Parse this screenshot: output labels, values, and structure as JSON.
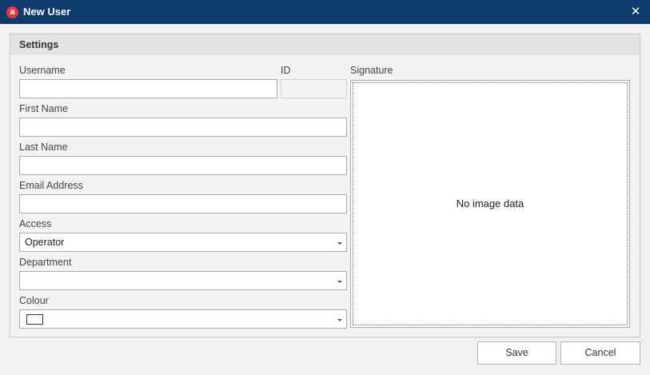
{
  "window": {
    "title": "New User",
    "app_icon_letter": "a"
  },
  "group": {
    "title": "Settings"
  },
  "fields": {
    "username": {
      "label": "Username",
      "value": ""
    },
    "id": {
      "label": "ID",
      "value": ""
    },
    "first_name": {
      "label": "First Name",
      "value": ""
    },
    "last_name": {
      "label": "Last Name",
      "value": ""
    },
    "email": {
      "label": "Email Address",
      "value": ""
    },
    "access": {
      "label": "Access",
      "value": "Operator"
    },
    "department": {
      "label": "Department",
      "value": ""
    },
    "colour": {
      "label": "Colour",
      "value": "#ffffff"
    }
  },
  "signature": {
    "label": "Signature",
    "empty_text": "No image data"
  },
  "buttons": {
    "save": "Save",
    "cancel": "Cancel"
  },
  "colors": {
    "titlebar": "#0e3b6e",
    "app_icon": "#e6383b"
  },
  "icons": {
    "close": "close-icon",
    "dropdown": "chevron-down-icon",
    "app": "app-logo-icon"
  }
}
